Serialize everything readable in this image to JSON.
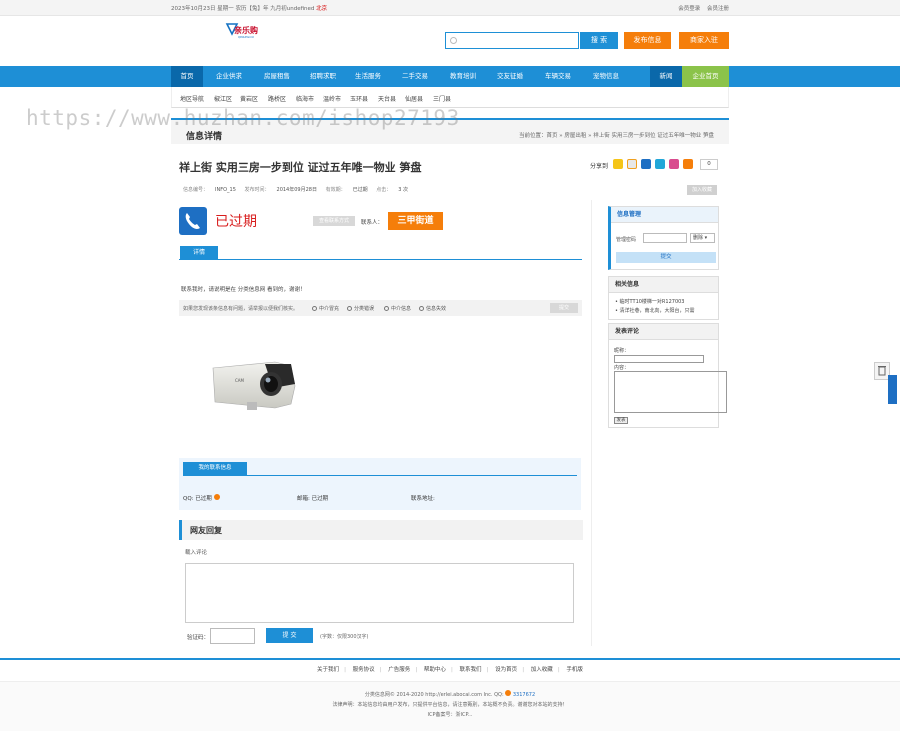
{
  "topbar": {
    "date_text": "2023年10月23日 星期一  农历【兔】年 九月初undefined",
    "weather": "北京",
    "links": [
      "会员登录",
      "会员注册"
    ]
  },
  "header": {
    "logo_text": "亲乐购",
    "logo_sub": "QINLEGOU",
    "search_placeholder": "",
    "search_button": "搜 索",
    "post_button": "发布信息",
    "merchant_button": "商家入驻"
  },
  "nav": {
    "home": "首页",
    "items": [
      "企业供求",
      "房屋租售",
      "招聘求职",
      "生活服务",
      "二手交易",
      "教育培训",
      "交友征婚",
      "车辆交易",
      "宠物信息"
    ],
    "news": "新闻",
    "biz": "企业首页"
  },
  "subnav": {
    "items": [
      "地区导航",
      "椒江区",
      "黄岩区",
      "路桥区",
      "临海市",
      "温岭市",
      "玉环县",
      "天台县",
      "仙居县",
      "三门县"
    ]
  },
  "watermark": "https://www.huzhan.com/ishop27193",
  "detail": {
    "heading": "信息详情",
    "breadcrumb": "当前位置：首页 » 房屋出租 » 祥上街 实用三房一步到位 证过五年唯一物业 笋盘",
    "title": "祥上街 实用三房一步到位 证过五年唯一物业 笋盘",
    "share_label": "分享到",
    "share_count": "0",
    "meta": {
      "id_label": "信息编号：",
      "id_value": "INFO_15",
      "date_label": "发布时间：",
      "date_value": "2014年09月28日",
      "valid_label": "有效期：",
      "valid_value": "已过期",
      "views_label": "点击：",
      "views_value": "3 次"
    },
    "fav_button": "加入收藏",
    "expired_text": "已过期",
    "report_button": "查看联系方式",
    "contact_label": "联系人：",
    "contact_name": "三甲街道",
    "tab_detail": "详情",
    "notice": "联系我时，请说明是在 分类信息网 看到的，谢谢！",
    "report_question": "如果您发现该条信息有问题，请举报以便我们核实。",
    "report_options": [
      "中介冒充",
      "分类错误",
      "中介信息",
      "信息失效"
    ],
    "report_submit": "提交"
  },
  "contact_panel": {
    "tab": "我的联系信息",
    "qq_label": "QQ:",
    "qq_value": "已过期",
    "mail_label": "邮箱:",
    "mail_value": "已过期",
    "addr_label": "联系地址:",
    "addr_value": ""
  },
  "replies": {
    "heading": "网友回复",
    "comment_label": "载入评论",
    "captcha_label": "验证码：",
    "submit": "提 交",
    "limit": "(字数：仅限300汉字)"
  },
  "sidebar": {
    "box1": {
      "title": "信息管理",
      "field_label": "管理密码",
      "select_value": "删除",
      "button": "提交"
    },
    "box2": {
      "title": "相关信息",
      "items": [
        "临时TT10楼梯一对R127003",
        "清洋社巷，南北向，大阳台，只需"
      ]
    },
    "box3": {
      "title": "发表评论",
      "name_label": "昵称：",
      "content_label": "内容：",
      "send": "发表"
    }
  },
  "footer": {
    "links": [
      "关于我们",
      "服务协议",
      "广告服务",
      "帮助中心",
      "联系我们",
      "设为首页",
      "加入收藏",
      "手机版"
    ],
    "copyright": "分类信息网© 2014-2020 http://erlei.abocai.com Inc. QQ:",
    "qq": "3317672",
    "disclaimer": "法律声明：本站信息均由用户发布，只提供平台信息，请注意甄别，本站概不负责。谢谢您对本站的支持！",
    "icp": "ICP备案号：浙ICP..."
  },
  "colors": {
    "primary": "#1e8fd6",
    "accent": "#f57e0a",
    "danger": "#d81e1e"
  }
}
